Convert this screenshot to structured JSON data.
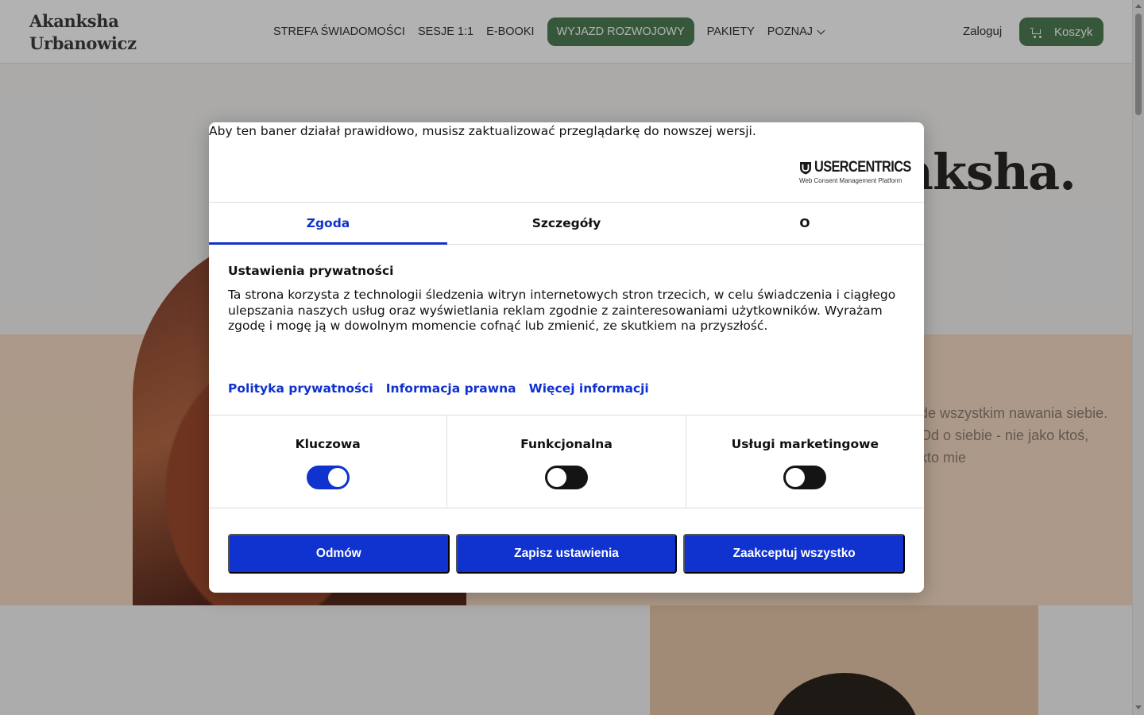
{
  "site": {
    "brand_line1": "Akanksha",
    "brand_line2": "Urbanowicz",
    "nav": [
      {
        "label": "STREFA ŚWIADOMOŚCI"
      },
      {
        "label": "SESJE 1:1"
      },
      {
        "label": "E-BOOKI"
      },
      {
        "label": "WYJAZD ROZWOJOWY"
      },
      {
        "label": "PAKIETY"
      },
      {
        "label": "POZNAJ"
      }
    ],
    "login_label": "Zaloguj",
    "cart_label": "Koszyk",
    "accent_color": "#4f7d55",
    "hero_heading": "nksha.",
    "hero_text": "de wszystkim nawania siebie. Od o siebie - nie jako ktoś, kto mie"
  },
  "consent": {
    "outdated_notice": "Aby ten baner działał prawidłowo, musisz zaktualizować przeglądarkę do nowszej wersji.",
    "logo": {
      "word": "USERCENTRICS",
      "tagline": "Web Consent Management Platform"
    },
    "tabs": [
      {
        "label": "Zgoda",
        "active": true
      },
      {
        "label": "Szczegóły",
        "active": false
      },
      {
        "label": "O",
        "active": false
      }
    ],
    "title": "Ustawienia prywatności",
    "description": "Ta strona korzysta z technologii śledzenia witryn internetowych stron trzecich, w celu świadczenia i ciągłego ulepszania naszych usług oraz wyświetlania reklam zgodnie z zainteresowaniami użytkowników. Wyrażam zgodę i mogę ją w dowolnym momencie cofnąć lub zmienić, ze skutkiem na przyszłość.",
    "links": [
      {
        "label": "Polityka prywatności"
      },
      {
        "label": "Informacja prawna"
      },
      {
        "label": "Więcej informacji"
      }
    ],
    "categories": [
      {
        "label": "Kluczowa",
        "enabled": true
      },
      {
        "label": "Funkcjonalna",
        "enabled": false
      },
      {
        "label": "Usługi marketingowe",
        "enabled": false
      }
    ],
    "buttons": {
      "deny": "Odmów",
      "save": "Zapisz ustawienia",
      "accept_all": "Zaakceptuj wszystko"
    },
    "accent_color": "#1032cf"
  }
}
